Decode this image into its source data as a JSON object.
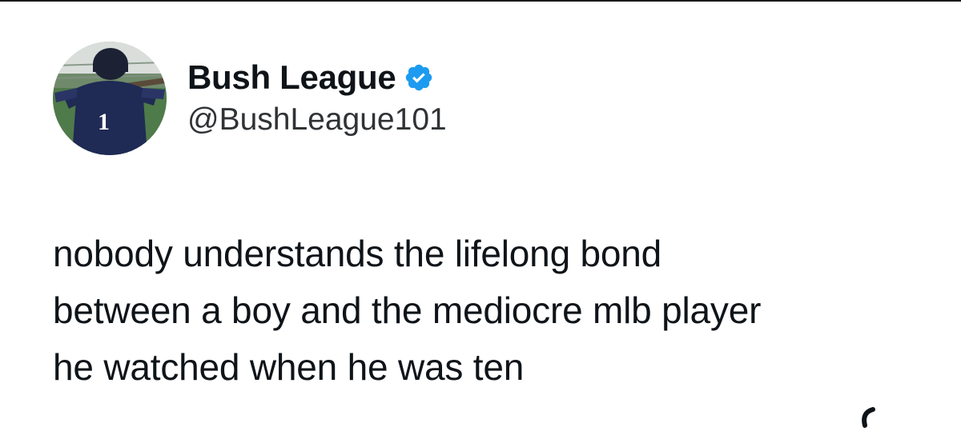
{
  "tweet": {
    "author": {
      "display_name": "Bush League",
      "handle": "@BushLeague101",
      "verified": true,
      "avatar_jersey_number": "1"
    },
    "text_lines": [
      "nobody understands the lifelong bond",
      "between a boy and the mediocre mlb player",
      "he watched when he was ten"
    ]
  },
  "colors": {
    "background": "#ffffff",
    "text": "#0f1419",
    "verified_badge": "#1d9bf0"
  },
  "icons": {
    "verified": "verified-badge-icon",
    "partial_glyph": "partial-glyph-icon"
  }
}
